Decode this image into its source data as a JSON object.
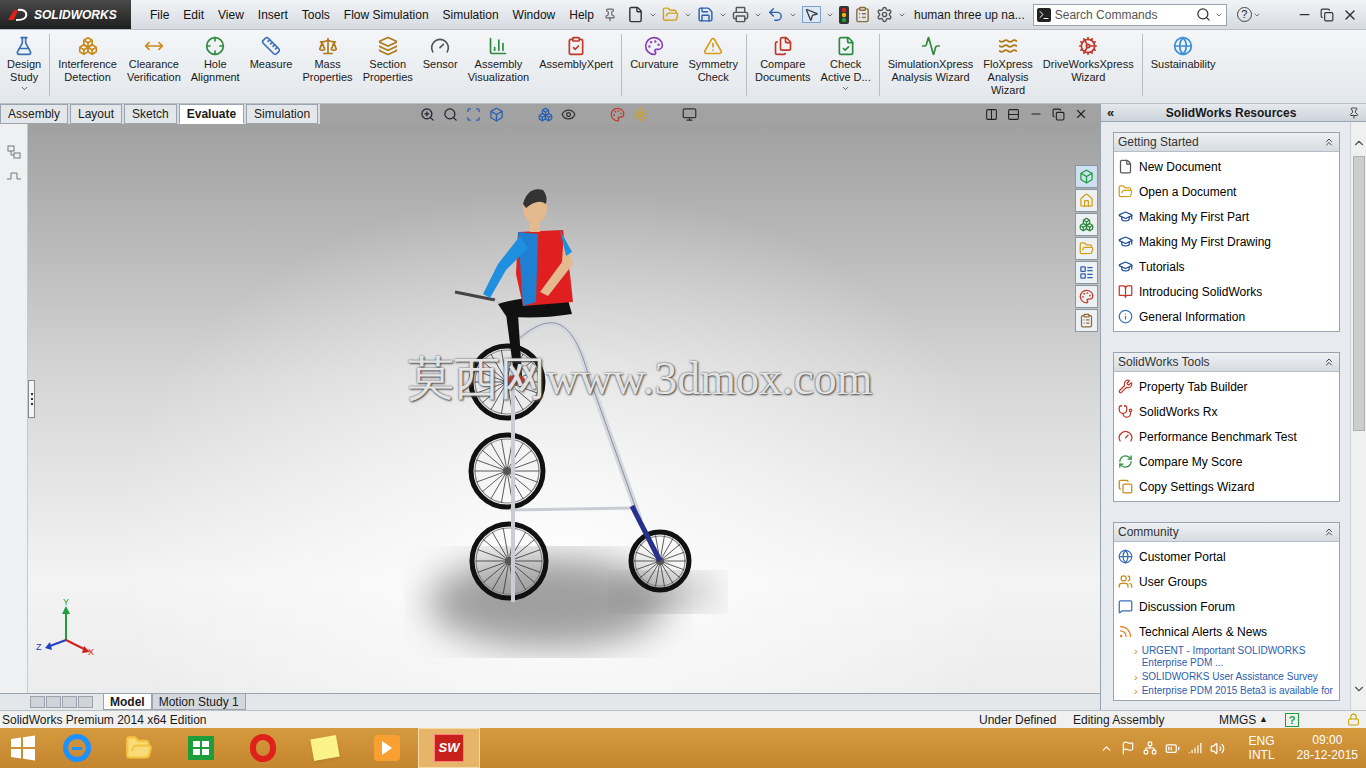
{
  "app": {
    "logo": "SOLIDWORKS",
    "document_name": "human three up na...",
    "search": {
      "placeholder": "Search Commands"
    },
    "help": "?"
  },
  "menu": [
    "File",
    "Edit",
    "View",
    "Insert",
    "Tools",
    "Flow Simulation",
    "Simulation",
    "Window",
    "Help"
  ],
  "command_groups": [
    [
      {
        "lines": [
          "Design",
          "Study"
        ],
        "dropdown": true
      }
    ],
    [
      {
        "lines": [
          "Interference",
          "Detection"
        ],
        "dropdown": false
      },
      {
        "lines": [
          "Clearance",
          "Verification"
        ],
        "dropdown": false
      },
      {
        "lines": [
          "Hole",
          "Alignment"
        ],
        "dropdown": false
      },
      {
        "lines": [
          "Measure"
        ],
        "dropdown": false
      },
      {
        "lines": [
          "Mass",
          "Properties"
        ],
        "dropdown": false
      },
      {
        "lines": [
          "Section",
          "Properties"
        ],
        "dropdown": false
      },
      {
        "lines": [
          "Sensor"
        ],
        "dropdown": false
      },
      {
        "lines": [
          "Assembly",
          "Visualization"
        ],
        "dropdown": false
      },
      {
        "lines": [
          "AssemblyXpert"
        ],
        "dropdown": false
      }
    ],
    [
      {
        "lines": [
          "Curvature"
        ],
        "dropdown": false
      },
      {
        "lines": [
          "Symmetry",
          "Check"
        ],
        "dropdown": false
      }
    ],
    [
      {
        "lines": [
          "Compare",
          "Documents"
        ],
        "dropdown": false
      },
      {
        "lines": [
          "Check",
          "Active D..."
        ],
        "dropdown": true
      }
    ],
    [
      {
        "lines": [
          "SimulationXpress",
          "Analysis Wizard"
        ],
        "dropdown": false
      },
      {
        "lines": [
          "FloXpress",
          "Analysis",
          "Wizard"
        ],
        "dropdown": false
      },
      {
        "lines": [
          "DriveWorksXpress",
          "Wizard"
        ],
        "dropdown": false
      }
    ],
    [
      {
        "lines": [
          "Sustainability"
        ],
        "dropdown": false
      }
    ]
  ],
  "tabs": [
    {
      "label": "Assembly",
      "selected": false
    },
    {
      "label": "Layout",
      "selected": false
    },
    {
      "label": "Sketch",
      "selected": false
    },
    {
      "label": "Evaluate",
      "selected": true
    },
    {
      "label": "Simulation",
      "selected": false
    }
  ],
  "viewport": {
    "watermark": "莫西网www.3dmox.com",
    "triad": {
      "x": "X",
      "y": "Y",
      "z": "Z"
    }
  },
  "resources": {
    "collapse": "«",
    "title": "SolidWorks Resources",
    "news_bullet": "›",
    "sections": [
      {
        "title": "Getting Started",
        "expanded": true,
        "items": [
          "New Document",
          "Open a Document",
          "Making My First Part",
          "Making My First Drawing",
          "Tutorials",
          "Introducing SolidWorks",
          "General Information"
        ],
        "news": []
      },
      {
        "title": "SolidWorks Tools",
        "expanded": true,
        "items": [
          "Property Tab Builder",
          "SolidWorks Rx",
          "Performance Benchmark Test",
          "Compare My Score",
          "Copy Settings Wizard"
        ],
        "news": []
      },
      {
        "title": "Community",
        "expanded": true,
        "items": [
          "Customer Portal",
          "User Groups",
          "Discussion Forum",
          "Technical Alerts & News"
        ],
        "news": [
          "URGENT - Important SOLIDWORKS Enterprise PDM ...",
          "SOLIDWORKS User Assistance Survey",
          "Enterprise PDM 2015 Beta3 is available for"
        ]
      }
    ]
  },
  "bottom_tabs": [
    {
      "label": "Model",
      "selected": true
    },
    {
      "label": "Motion Study 1",
      "selected": false
    }
  ],
  "status_bar": {
    "product": "SolidWorks Premium 2014 x64 Edition",
    "state": "Under Defined",
    "mode": "Editing Assembly",
    "units": "MMGS",
    "units_arrow": "▲",
    "help": "?"
  },
  "taskbar": {
    "apps": [
      {
        "kind": "ie",
        "active": false
      },
      {
        "kind": "explorer",
        "active": false
      },
      {
        "kind": "store",
        "active": false
      },
      {
        "kind": "opera",
        "active": false
      },
      {
        "kind": "notes",
        "active": false
      },
      {
        "kind": "media",
        "active": false
      },
      {
        "kind": "solidworks",
        "active": true
      }
    ],
    "sw_icon_text": "SW",
    "language": [
      "ENG",
      "INTL"
    ],
    "time": "09:00",
    "date": "28-12-2015"
  }
}
